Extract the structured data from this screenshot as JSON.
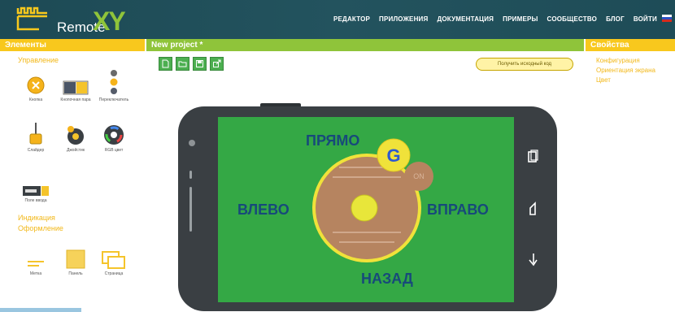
{
  "header": {
    "logo_text": "Remote",
    "logo_xy": "XY",
    "nav": [
      "РЕДАКТОР",
      "ПРИЛОЖЕНИЯ",
      "ДОКУМЕНТАЦИЯ",
      "ПРИМЕРЫ",
      "СООБЩЕСТВО",
      "БЛОГ",
      "ВОЙТИ"
    ]
  },
  "sidebar": {
    "title": "Элементы",
    "section1": "Управление",
    "widgets": [
      {
        "label": "Кнопка",
        "icon": "button-icon"
      },
      {
        "label": "Кнопочная пара",
        "icon": "switch-icon"
      },
      {
        "label": "Переключатель",
        "icon": "traffic-switch-icon"
      },
      {
        "label": "Слайдер",
        "icon": "slider-icon"
      },
      {
        "label": "Джойстик",
        "icon": "joystick-icon"
      },
      {
        "label": "RGB цвет",
        "icon": "color-wheel-icon"
      },
      {
        "label": "Поле ввода",
        "icon": "text-edit-icon"
      },
      {
        "label": "Метка",
        "icon": "label-icon"
      },
      {
        "label": "Панель",
        "icon": "panel-icon"
      },
      {
        "label": "Страница",
        "icon": "page-icon"
      }
    ],
    "section2": "Индикация",
    "section3": "Оформление"
  },
  "center": {
    "title": "New project *",
    "source_button": "Получить исходный код",
    "directions": {
      "up": "ПРЯМО",
      "down": "НАЗАД",
      "left": "ВЛЕВО",
      "right": "ВПРАВО"
    },
    "g_badge": "G",
    "on_label": "ON"
  },
  "properties": {
    "title": "Свойства",
    "items": [
      "Конфигурация",
      "Ориентация экрана",
      "Цвет"
    ]
  },
  "colors": {
    "header_bg": "#1d4a55",
    "accent_yellow": "#f8c81d",
    "accent_green": "#8fc43a",
    "screen_green": "#34a845",
    "direction_text": "#174a7a"
  }
}
